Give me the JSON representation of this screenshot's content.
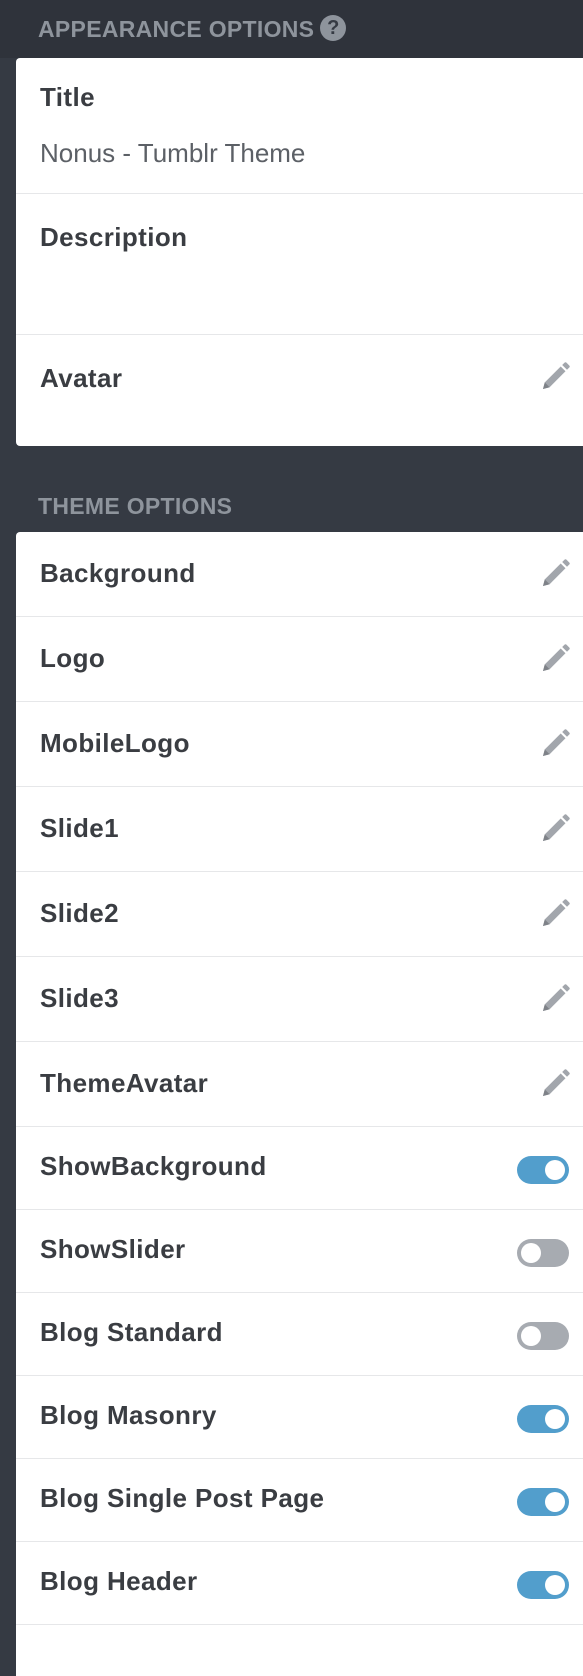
{
  "appearance": {
    "header": "APPEARANCE OPTIONS",
    "help_icon": "?",
    "title_label": "Title",
    "title_value": "Nonus - Tumblr Theme",
    "description_label": "Description",
    "description_value": "",
    "avatar_label": "Avatar"
  },
  "theme": {
    "header": "THEME OPTIONS",
    "image_options": [
      {
        "label": "Background",
        "icon": "pencil-icon"
      },
      {
        "label": "Logo",
        "icon": "pencil-icon"
      },
      {
        "label": "MobileLogo",
        "icon": "pencil-icon"
      },
      {
        "label": "Slide1",
        "icon": "pencil-icon"
      },
      {
        "label": "Slide2",
        "icon": "pencil-icon"
      },
      {
        "label": "Slide3",
        "icon": "pencil-icon"
      },
      {
        "label": "ThemeAvatar",
        "icon": "pencil-icon"
      }
    ],
    "toggle_options": [
      {
        "label": "ShowBackground",
        "on": true
      },
      {
        "label": "ShowSlider",
        "on": false
      },
      {
        "label": "Blog Standard",
        "on": false
      },
      {
        "label": "Blog Masonry",
        "on": true
      },
      {
        "label": "Blog Single Post Page",
        "on": true
      },
      {
        "label": "Blog Header",
        "on": true
      }
    ]
  },
  "colors": {
    "sidebar_bg": "#353a43",
    "header_text": "#8e949c",
    "toggle_on": "#529ecc",
    "toggle_off": "#a7abb1",
    "label_text": "#3a3d42",
    "icon_gray": "#9a9ea4"
  }
}
